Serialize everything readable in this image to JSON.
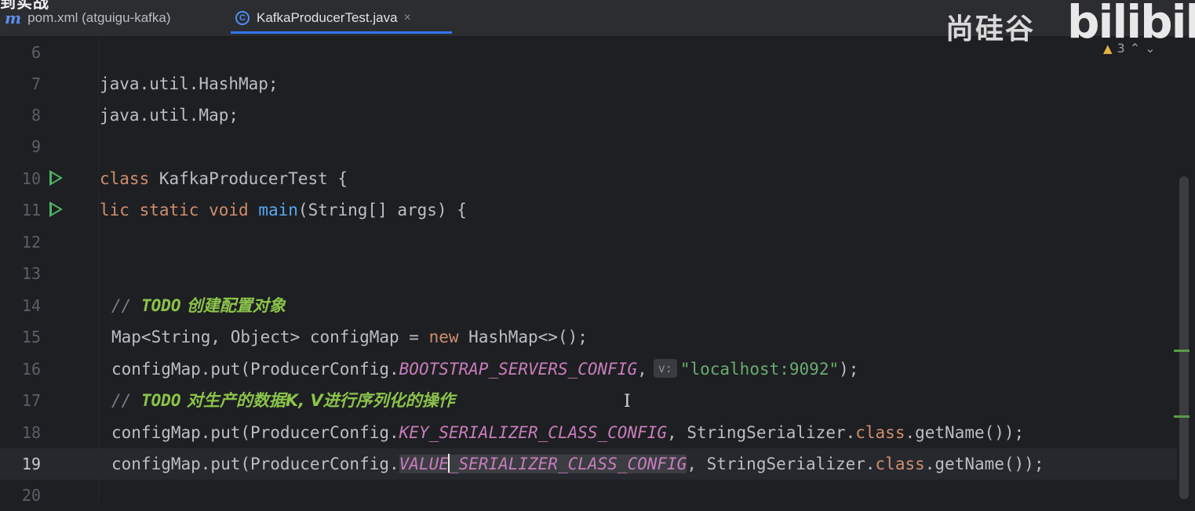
{
  "overlay": {
    "video_title_fragment": "到实战"
  },
  "tabs": [
    {
      "label": "pom.xml (atguigu-kafka)",
      "icon": "m"
    },
    {
      "label": "KafkaProducerTest.java",
      "icon": "C",
      "close": "×"
    }
  ],
  "watermark": {
    "brand": "尚硅谷",
    "site": "bilibili"
  },
  "inspections": {
    "warning_count": "3"
  },
  "editor": {
    "lines": [
      {
        "num": "6"
      },
      {
        "num": "7",
        "t1": "java.util.HashMap;"
      },
      {
        "num": "8",
        "t1": "java.util.Map;"
      },
      {
        "num": "9"
      },
      {
        "num": "10",
        "kw": "class",
        "t1": " KafkaProducerTest {"
      },
      {
        "num": "11",
        "kw1": "lic",
        "kw2": "static",
        "kw3": "void",
        "fn": "main",
        "t1": "(String[] args) {"
      },
      {
        "num": "12"
      },
      {
        "num": "13"
      },
      {
        "num": "14",
        "cmt": "// ",
        "todo": "TODO",
        "text": " 创建配置对象"
      },
      {
        "num": "15",
        "t1": "Map<String, Object> configMap = ",
        "kw": "new",
        "t2": " HashMap<>();"
      },
      {
        "num": "16",
        "t1": "configMap.put(ProducerConfig.",
        "cst": "BOOTSTRAP_SERVERS_CONFIG",
        "t2": ",",
        "hint": "v:",
        "str": "\"localhost:9092\"",
        "t3": ");"
      },
      {
        "num": "17",
        "cmt": "// ",
        "todo": "TODO",
        "text": " 对生产的数据K, V进行序列化的操作"
      },
      {
        "num": "18",
        "t1": "configMap.put(ProducerConfig.",
        "cst": "KEY_SERIALIZER_CLASS_CONFIG",
        "t2": ", StringSerializer.",
        "kw": "class",
        "t3": ".getName());"
      },
      {
        "num": "19",
        "t1": "configMap.put(ProducerConfig.",
        "cst1": "VALUE",
        "cst2": "_SERIALIZER_CLASS_CONFIG",
        "t2": ", StringSerializer.",
        "kw": "class",
        "t3": ".getName());"
      },
      {
        "num": "20"
      }
    ]
  },
  "colors": {
    "background": "#1e1f22",
    "keyword": "#cf8e6d",
    "method": "#56a8f5",
    "constant": "#c77dbb",
    "string": "#6aab73",
    "todo": "#8bc34a",
    "run_icon": "#4fb364",
    "tab_accent": "#3574f0"
  }
}
